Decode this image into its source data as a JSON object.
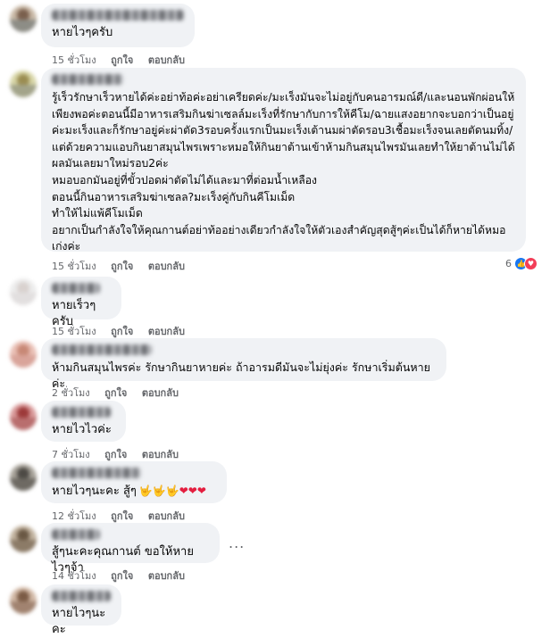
{
  "colors": {
    "bubble": "#f0f2f5",
    "meta": "#65676b",
    "like": "#1877f2",
    "love": "#f33e58"
  },
  "comments": [
    {
      "text": "หายไวๆครับ",
      "time": "15 ชั่วโมง",
      "like": "ถูกใจ",
      "reply": "ตอบกลับ"
    },
    {
      "text": "รู้เร็วรักษาเร็วหายได้ค่ะอย่าท้อค่ะอย่าเครียดค่ะ/มะเร็งมันจะไม่อยู่กับคนอารมณ์ดี/และนอนพักผ่อนให้เพียงพอค่ะตอนนี้มีอาหารเสริมกินฆ่าเซลล์มะเร็งที่รักษากับการให้คีโม/ฉายแสงอยากจะบอกว่าเป็นอยู่ค่ะมะเร็งและก็รักษาอยู่ค่ะผ่าตัด3รอบครั้งแรกเป็นมะเร็งเต้านมผ่าตัดรอบ3เชื้อมะเร็งจนเลยตัดนมทิ้ง/แต่ด้วยความแอบกินยาสมุนไพรเพราะหมอให้กินยาต้านเข้าห้ามกินสมุนไพรมันเลยทำให้ยาต้านไม่ได้ผลมันเลยมาใหม่รอบ2ค่ะ\nหมอบอกมันอยู่ที่ขั้วปอดผ่าตัดไม่ได้และมาที่ต่อมน้ำเหลือง\nตอนนี้กินอาหารเสริมฆ่าเซลล?มะเร็งคู่กับกินคีโมเม็ด\nทำให้ไม่แพ้คีโมเม็ด\nอยากเป็นกำลังใจให้คุณกานต์อย่าท้ออย่างเดียวกำลังใจให้ตัวเองสำคัญสุดสู้ๆค่ะเป็นได้ก็หายได้หมอเก่งค่ะ",
      "time": "15 ชั่วโมง",
      "like": "ถูกใจ",
      "reply": "ตอบกลับ",
      "reaction_count": "6",
      "reaction_icons": [
        "like-icon",
        "love-icon"
      ]
    },
    {
      "text": "หายเร็วๆครับ",
      "time": "15 ชั่วโมง",
      "like": "ถูกใจ",
      "reply": "ตอบกลับ"
    },
    {
      "text": "ห้ามกินสมุนไพรค่ะ รักษากินยาหายค่ะ ถ้าอารมดีมันจะไม่ยุ่งค่ะ รักษาเริ่มต้นหายค่ะ",
      "time": "2 ชั่วโมง",
      "like": "ถูกใจ",
      "reply": "ตอบกลับ"
    },
    {
      "text": "หายไวไวค่ะ",
      "time": "7 ชั่วโมง",
      "like": "ถูกใจ",
      "reply": "ตอบกลับ"
    },
    {
      "text": "หายไวๆนะคะ สู้ๆ",
      "emoji": "🤟🤟🤟❤❤❤",
      "time": "12 ชั่วโมง",
      "like": "ถูกใจ",
      "reply": "ตอบกลับ"
    },
    {
      "text": "สู้ๆนะคะคุณกานต์ ขอให้หายไวๆจ้า",
      "time": "14 ชั่วโมง",
      "like": "ถูกใจ",
      "reply": "ตอบกลับ",
      "more": "..."
    },
    {
      "text": "หายไวๆนะคะ"
    }
  ]
}
